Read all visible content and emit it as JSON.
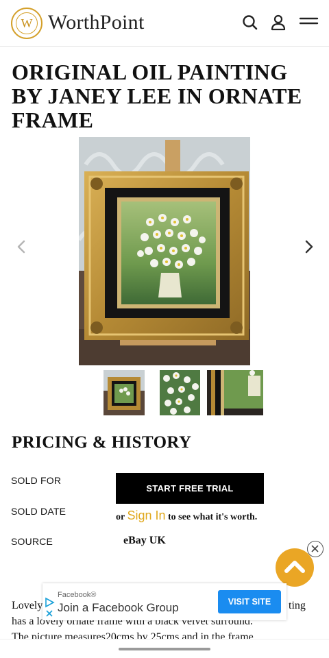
{
  "header": {
    "logo_letter": "W",
    "logo_text": "WorthPoint",
    "icons": [
      "search-icon",
      "user-icon",
      "menu-icon"
    ]
  },
  "item": {
    "title": "ORIGINAL OIL PAINTING BY JANEY LEE IN ORNATE FRAME",
    "thumbnail_count": 3
  },
  "pricing": {
    "heading": "PRICING & HISTORY",
    "sold_for_label": "SOLD FOR",
    "sold_date_label": "SOLD DATE",
    "source_label": "SOURCE",
    "trial_button": "START FREE TRIAL",
    "or_text": "or",
    "signin_link": "Sign In",
    "signin_suffix": "to see what it's worth.",
    "source_value": "eBay UK"
  },
  "description": {
    "line1_start": "Lovely",
    "line1_end": "ting",
    "line2": "has a lovely ornate frame with a black velvet surround.",
    "line3": "The picture measures20cms by 25cms and in the frame"
  },
  "ad": {
    "source": "Facebook®",
    "title": "Join a Facebook Group",
    "button": "VISIT SITE"
  },
  "colors": {
    "accent_gold": "#eaa625",
    "signin": "#e0a81c",
    "ad_button": "#1a8cf0",
    "trial_button": "#000000"
  }
}
